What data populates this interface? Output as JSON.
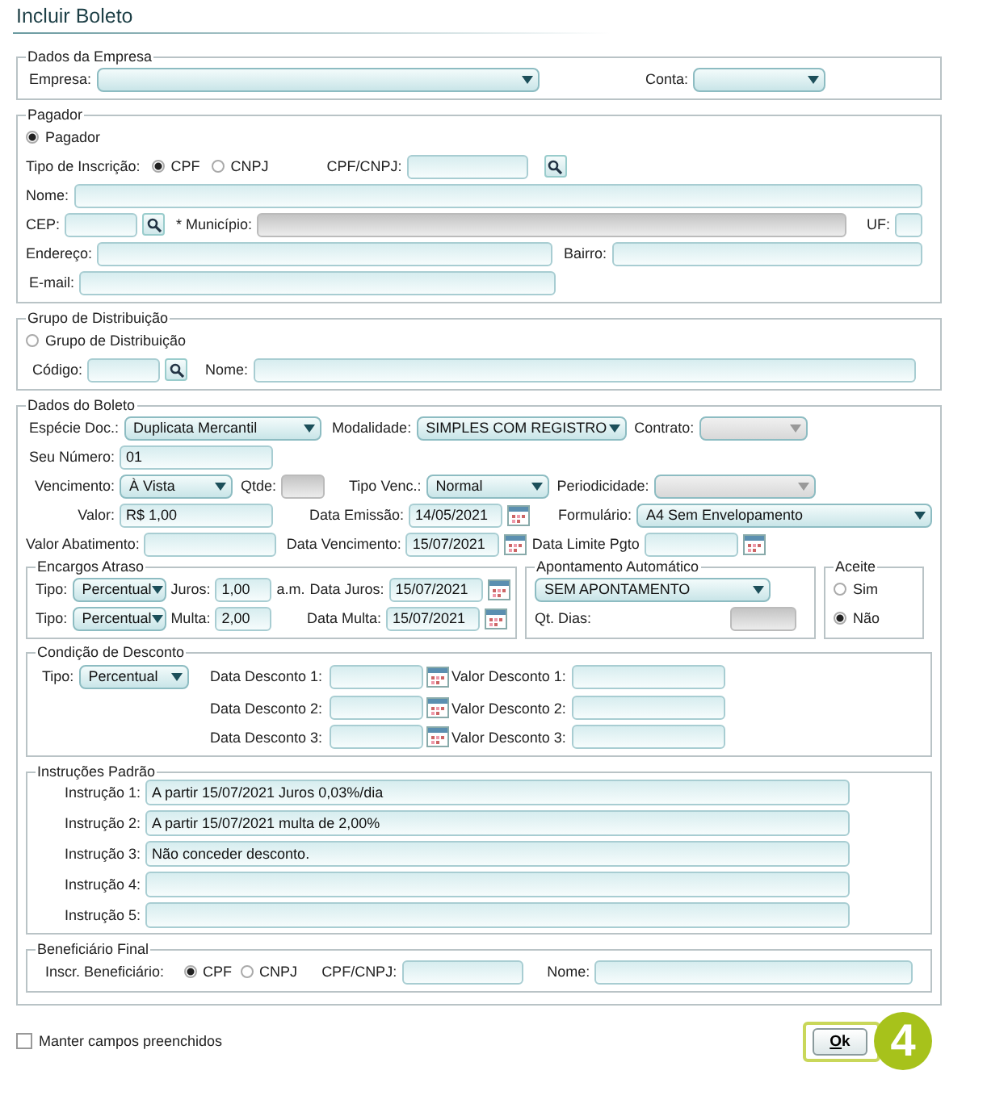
{
  "title": "Incluir Boleto",
  "empresa": {
    "legend": "Dados da Empresa",
    "empresa": {
      "label": "Empresa:"
    },
    "conta": {
      "label": "Conta:"
    }
  },
  "pagador": {
    "legend": "Pagador",
    "option": {
      "label": "Pagador",
      "selected": true
    },
    "tipo_inscricao": {
      "label": "Tipo de Inscrição:",
      "options": [
        {
          "label": "CPF",
          "selected": true
        },
        {
          "label": "CNPJ",
          "selected": false
        }
      ]
    },
    "cpf_cnpj": {
      "label": "CPF/CNPJ:"
    },
    "nome": {
      "label": "Nome:"
    },
    "cep": {
      "label": "CEP:"
    },
    "municipio": {
      "label": "* Município:",
      "disabled": true
    },
    "uf": {
      "label": "UF:"
    },
    "endereco": {
      "label": "Endereço:"
    },
    "bairro": {
      "label": "Bairro:"
    },
    "email": {
      "label": "E-mail:"
    }
  },
  "grupo": {
    "legend": "Grupo de Distribuição",
    "option": {
      "label": "Grupo de Distribuição",
      "selected": false
    },
    "codigo": {
      "label": "Código:"
    },
    "nome": {
      "label": "Nome:"
    }
  },
  "boleto": {
    "legend": "Dados do Boleto",
    "especie": {
      "label": "Espécie Doc.:",
      "value": "Duplicata Mercantil"
    },
    "modalidade": {
      "label": "Modalidade:",
      "value": "SIMPLES COM REGISTRO"
    },
    "contrato": {
      "label": "Contrato:",
      "disabled": true
    },
    "seu_numero": {
      "label": "Seu Número:",
      "value": "01"
    },
    "vencimento": {
      "label": "Vencimento:",
      "value": "À Vista"
    },
    "qtde": {
      "label": "Qtde:",
      "disabled": true
    },
    "tipo_venc": {
      "label": "Tipo Venc.:",
      "value": "Normal"
    },
    "periodicidade": {
      "label": "Periodicidade:",
      "disabled": true
    },
    "valor": {
      "label": "Valor:",
      "value": "R$ 1,00"
    },
    "data_emissao": {
      "label": "Data Emissão:",
      "value": "14/05/2021"
    },
    "formulario": {
      "label": "Formulário:",
      "value": "A4 Sem Envelopamento"
    },
    "valor_abatimento": {
      "label": "Valor Abatimento:"
    },
    "data_vencimento": {
      "label": "Data Vencimento:",
      "value": "15/07/2021"
    },
    "data_limite": {
      "label": "Data Limite Pgto"
    },
    "encargos": {
      "legend": "Encargos Atraso",
      "rows": [
        {
          "tipo": {
            "label": "Tipo:",
            "value": "Percentual"
          },
          "taxa": {
            "label": "Juros:",
            "value": "1,00"
          },
          "unit": "a.m.",
          "data": {
            "label": "Data Juros:",
            "value": "15/07/2021"
          }
        },
        {
          "tipo": {
            "label": "Tipo:",
            "value": "Percentual"
          },
          "taxa": {
            "label": "Multa:",
            "value": "2,00"
          },
          "data": {
            "label": "Data Multa:",
            "value": "15/07/2021"
          }
        }
      ]
    },
    "apontamento": {
      "legend": "Apontamento Automático",
      "value": "SEM APONTAMENTO",
      "qt_dias": {
        "label": "Qt. Dias:",
        "disabled": true
      }
    },
    "aceite": {
      "legend": "Aceite",
      "options": [
        {
          "label": "Sim",
          "selected": false
        },
        {
          "label": "Não",
          "selected": true
        }
      ]
    },
    "desconto": {
      "legend": "Condição de Desconto",
      "tipo": {
        "label": "Tipo:",
        "value": "Percentual"
      },
      "rows": [
        {
          "data_label": "Data Desconto 1:",
          "valor_label": "Valor Desconto 1:"
        },
        {
          "data_label": "Data Desconto 2:",
          "valor_label": "Valor Desconto 2:"
        },
        {
          "data_label": "Data Desconto 3:",
          "valor_label": "Valor Desconto 3:"
        }
      ]
    },
    "instrucoes": {
      "legend": "Instruções Padrão",
      "rows": [
        {
          "label": "Instrução 1:",
          "value": "A partir 15/07/2021 Juros 0,03%/dia"
        },
        {
          "label": "Instrução 2:",
          "value": "A partir 15/07/2021 multa de 2,00%"
        },
        {
          "label": "Instrução 3:",
          "value": "Não conceder desconto."
        },
        {
          "label": "Instrução 4:"
        },
        {
          "label": "Instrução 5:"
        }
      ]
    },
    "beneficiario": {
      "legend": "Beneficiário Final",
      "label": "Inscr. Beneficiário:",
      "options": [
        {
          "label": "CPF",
          "selected": true
        },
        {
          "label": "CNPJ",
          "selected": false
        }
      ],
      "cpf_cnpj": {
        "label": "CPF/CNPJ:"
      },
      "nome": {
        "label": "Nome:"
      }
    }
  },
  "manter": {
    "label": "Manter campos preenchidos",
    "checked": false
  },
  "ok_button": "Ok",
  "step_badge": "4"
}
